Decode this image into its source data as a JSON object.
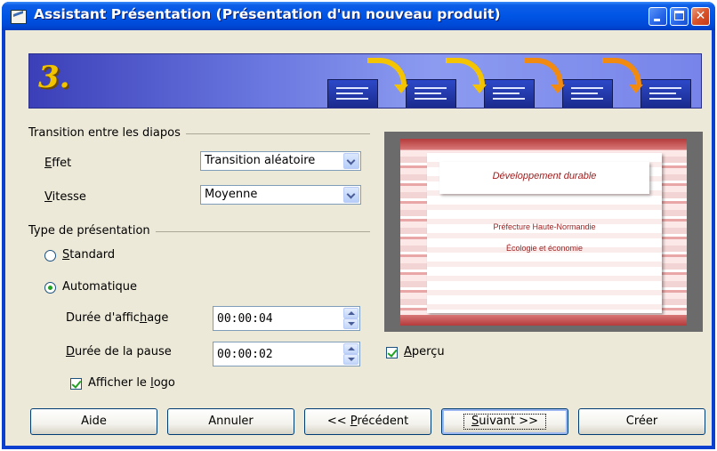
{
  "window": {
    "title": "Assistant Présentation (Présentation d'un nouveau produit)",
    "buttons": {
      "minimize": "minimize",
      "maximize": "maximize",
      "close": "close"
    }
  },
  "banner": {
    "step": "3."
  },
  "transition_group": {
    "label": "Transition entre les diapos",
    "effect_label": "Effet",
    "effect_value": "Transition aléatoire",
    "speed_label": "Vitesse",
    "speed_value": "Moyenne"
  },
  "presentation_type": {
    "label": "Type de présentation",
    "standard_label": "Standard",
    "automatic_label": "Automatique",
    "selected": "Automatique",
    "display_duration_label": "Durée d'affichage",
    "display_duration_value": "00:00:04",
    "pause_duration_label": "Durée de la pause",
    "pause_duration_value": "00:00:02",
    "show_logo_label": "Afficher le logo",
    "show_logo_checked": true
  },
  "preview": {
    "slide_title": "Développement durable",
    "slide_line1": "Préfecture Haute-Normandie",
    "slide_line2": "Écologie et économie",
    "preview_label": "Aperçu",
    "preview_checked": true
  },
  "footer": {
    "help": "Aide",
    "cancel": "Annuler",
    "previous": "<< Précédent",
    "next": "Suivant >>",
    "create": "Créer"
  },
  "colors": {
    "titlebar": "#0055e5",
    "dialog_bg": "#ece9d8",
    "slide_accent": "#b53a3a"
  }
}
